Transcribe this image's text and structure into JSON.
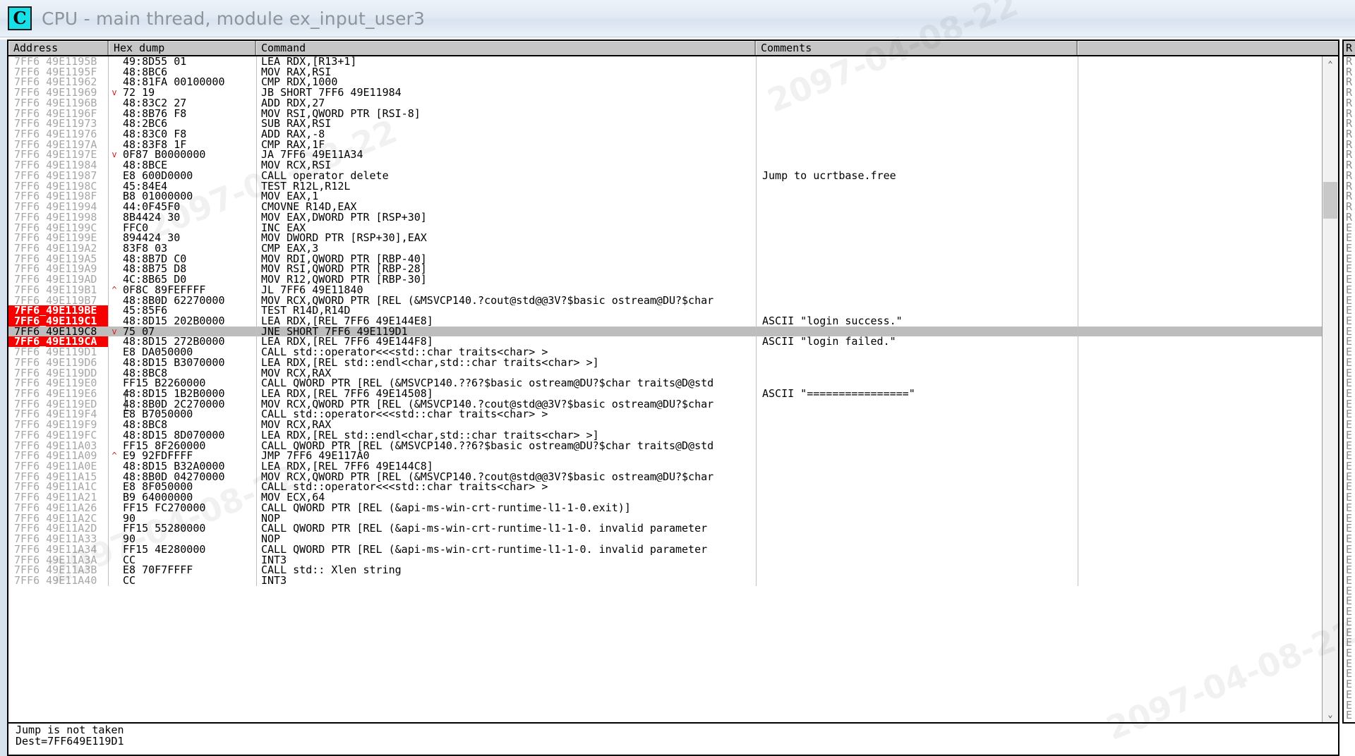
{
  "window": {
    "icon": "cpu-debugger-icon",
    "icon_glyph": "C",
    "title": "CPU - main thread, module ex_input_user3"
  },
  "watermark": {
    "text": "2097-04-08-22"
  },
  "columns": {
    "address": "Address",
    "hexdump": "Hex dump",
    "command": "Command",
    "comments": "Comments",
    "tail": ""
  },
  "right_pane": {
    "header": "R",
    "rows": [
      "R",
      "R",
      "R",
      "R",
      "R",
      "R",
      "R",
      "R",
      "R",
      "R",
      "R",
      "R",
      "R",
      "R",
      "R",
      "R",
      "E",
      "E",
      "E",
      "E",
      "E",
      "E",
      "E",
      "E",
      "E",
      "E",
      "E",
      "E",
      "E",
      "E",
      "E",
      "E",
      "E",
      "E",
      "E",
      "E",
      "E",
      "E",
      "E",
      "E",
      "E",
      "E",
      "E",
      "E",
      "E",
      "E",
      "E",
      "E",
      "E",
      "E",
      "E",
      "E",
      "E",
      "E",
      "E",
      "E",
      "E",
      "E",
      "E",
      "E",
      "E",
      "E",
      "E",
      "E"
    ]
  },
  "statusbar": {
    "line1": "Jump is not taken",
    "line2": "Dest=7FF649E119D1"
  },
  "colors": {
    "breakpoint_bg": "#f90000",
    "breakpoint_fg": "#ffffff",
    "selected_bg": "#bdbdbd",
    "address_fg": "#a7a7a7",
    "header_bg": "#c6c6c6",
    "arrow_fg": "#d02020",
    "icon_bg": "#18e0e8",
    "title_fg": "#8e949c"
  },
  "rows": [
    {
      "addr": "7FF6_49E1195B",
      "arrow": "",
      "hex": "49:8D55 01",
      "cmd": "LEA RDX,[R13+1]",
      "cmt": "",
      "bp": false,
      "sel": false
    },
    {
      "addr": "7FF6_49E1195F",
      "arrow": "",
      "hex": "48:8BC6",
      "cmd": "MOV RAX,RSI",
      "cmt": "",
      "bp": false,
      "sel": false
    },
    {
      "addr": "7FF6_49E11962",
      "arrow": "",
      "hex": "48:81FA 00100000",
      "cmd": "CMP RDX,1000",
      "cmt": "",
      "bp": false,
      "sel": false
    },
    {
      "addr": "7FF6_49E11969",
      "arrow": "v",
      "hex": "72 19",
      "cmd": "JB SHORT 7FF6_49E11984",
      "cmt": "",
      "bp": false,
      "sel": false
    },
    {
      "addr": "7FF6_49E1196B",
      "arrow": "",
      "hex": "48:83C2 27",
      "cmd": "ADD RDX,27",
      "cmt": "",
      "bp": false,
      "sel": false
    },
    {
      "addr": "7FF6_49E1196F",
      "arrow": "",
      "hex": "48:8B76 F8",
      "cmd": "MOV RSI,QWORD PTR [RSI-8]",
      "cmt": "",
      "bp": false,
      "sel": false
    },
    {
      "addr": "7FF6_49E11973",
      "arrow": "",
      "hex": "48:2BC6",
      "cmd": "SUB RAX,RSI",
      "cmt": "",
      "bp": false,
      "sel": false
    },
    {
      "addr": "7FF6_49E11976",
      "arrow": "",
      "hex": "48:83C0 F8",
      "cmd": "ADD RAX,-8",
      "cmt": "",
      "bp": false,
      "sel": false
    },
    {
      "addr": "7FF6_49E1197A",
      "arrow": "",
      "hex": "48:83F8 1F",
      "cmd": "CMP RAX,1F",
      "cmt": "",
      "bp": false,
      "sel": false
    },
    {
      "addr": "7FF6_49E1197E",
      "arrow": "v",
      "hex": "0F87 B0000000",
      "cmd": "JA 7FF6_49E11A34",
      "cmt": "",
      "bp": false,
      "sel": false
    },
    {
      "addr": "7FF6_49E11984",
      "arrow": "",
      "hex": "48:8BCE",
      "cmd": "MOV RCX,RSI",
      "cmt": "",
      "bp": false,
      "sel": false
    },
    {
      "addr": "7FF6_49E11987",
      "arrow": "",
      "hex": "E8 600D0000",
      "cmd": "CALL operator delete",
      "cmt": "Jump to ucrtbase.free",
      "bp": false,
      "sel": false
    },
    {
      "addr": "7FF6_49E1198C",
      "arrow": "",
      "hex": "45:84E4",
      "cmd": "TEST R12L,R12L",
      "cmt": "",
      "bp": false,
      "sel": false
    },
    {
      "addr": "7FF6_49E1198F",
      "arrow": "",
      "hex": "B8 01000000",
      "cmd": "MOV EAX,1",
      "cmt": "",
      "bp": false,
      "sel": false
    },
    {
      "addr": "7FF6_49E11994",
      "arrow": "",
      "hex": "44:0F45F0",
      "cmd": "CMOVNE R14D,EAX",
      "cmt": "",
      "bp": false,
      "sel": false
    },
    {
      "addr": "7FF6_49E11998",
      "arrow": "",
      "hex": "8B4424 30",
      "cmd": "MOV EAX,DWORD PTR [RSP+30]",
      "cmt": "",
      "bp": false,
      "sel": false
    },
    {
      "addr": "7FF6_49E1199C",
      "arrow": "",
      "hex": "FFC0",
      "cmd": "INC EAX",
      "cmt": "",
      "bp": false,
      "sel": false
    },
    {
      "addr": "7FF6_49E1199E",
      "arrow": "",
      "hex": "894424 30",
      "cmd": "MOV DWORD PTR [RSP+30],EAX",
      "cmt": "",
      "bp": false,
      "sel": false
    },
    {
      "addr": "7FF6_49E119A2",
      "arrow": "",
      "hex": "83F8 03",
      "cmd": "CMP EAX,3",
      "cmt": "",
      "bp": false,
      "sel": false
    },
    {
      "addr": "7FF6_49E119A5",
      "arrow": "",
      "hex": "48:8B7D C0",
      "cmd": "MOV RDI,QWORD PTR [RBP-40]",
      "cmt": "",
      "bp": false,
      "sel": false
    },
    {
      "addr": "7FF6_49E119A9",
      "arrow": "",
      "hex": "48:8B75 D8",
      "cmd": "MOV RSI,QWORD PTR [RBP-28]",
      "cmt": "",
      "bp": false,
      "sel": false
    },
    {
      "addr": "7FF6_49E119AD",
      "arrow": "",
      "hex": "4C:8B65 D0",
      "cmd": "MOV R12,QWORD PTR [RBP-30]",
      "cmt": "",
      "bp": false,
      "sel": false
    },
    {
      "addr": "7FF6_49E119B1",
      "arrow": "^",
      "hex": "0F8C 89FEFFFF",
      "cmd": "JL 7FF6_49E11840",
      "cmt": "",
      "bp": false,
      "sel": false
    },
    {
      "addr": "7FF6_49E119B7",
      "arrow": "",
      "hex": "48:8B0D 62270000",
      "cmd": "MOV RCX,QWORD PTR [REL (&MSVCP140.?cout@std@@3V?$basic_ostream@DU?$char",
      "cmt": "",
      "bp": false,
      "sel": false
    },
    {
      "addr": "7FF6_49E119BE",
      "arrow": "",
      "hex": "45:85F6",
      "cmd": "TEST R14D,R14D",
      "cmt": "",
      "bp": true,
      "sel": false
    },
    {
      "addr": "7FF6_49E119C1",
      "arrow": "",
      "hex": "48:8D15 202B0000",
      "cmd": "LEA RDX,[REL 7FF6_49E144E8]",
      "cmt": "ASCII \"login success.\"",
      "bp": true,
      "sel": false
    },
    {
      "addr": "7FF6_49E119C8",
      "arrow": "v",
      "hex": "75 07",
      "cmd": "JNE SHORT 7FF6_49E119D1",
      "cmt": "",
      "bp": false,
      "sel": true
    },
    {
      "addr": "7FF6_49E119CA",
      "arrow": "",
      "hex": "48:8D15 272B0000",
      "cmd": "LEA RDX,[REL 7FF6_49E144F8]",
      "cmt": "ASCII \"login failed.\"",
      "bp": true,
      "sel": false
    },
    {
      "addr": "7FF6_49E119D1",
      "arrow": "",
      "hex": "E8 DA050000",
      "cmd": "CALL std::operator<<<std::char_traits<char> >",
      "cmt": "",
      "bp": false,
      "sel": false
    },
    {
      "addr": "7FF6_49E119D6",
      "arrow": "",
      "hex": "48:8D15 B3070000",
      "cmd": "LEA RDX,[REL std::endl<char,std::char_traits<char> >]",
      "cmt": "",
      "bp": false,
      "sel": false
    },
    {
      "addr": "7FF6_49E119DD",
      "arrow": "",
      "hex": "48:8BC8",
      "cmd": "MOV RCX,RAX",
      "cmt": "",
      "bp": false,
      "sel": false
    },
    {
      "addr": "7FF6_49E119E0",
      "arrow": "",
      "hex": "FF15 B2260000",
      "cmd": "CALL QWORD PTR [REL (&MSVCP140.??6?$basic_ostream@DU?$char_traits@D@std",
      "cmt": "",
      "bp": false,
      "sel": false
    },
    {
      "addr": "7FF6_49E119E6",
      "arrow": "",
      "hex": "48:8D15 1B2B0000",
      "cmd": "LEA RDX,[REL 7FF6_49E14508]",
      "cmt": "ASCII \"================\"",
      "bp": false,
      "sel": false
    },
    {
      "addr": "7FF6_49E119ED",
      "arrow": "",
      "hex": "48:8B0D 2C270000",
      "cmd": "MOV RCX,QWORD PTR [REL (&MSVCP140.?cout@std@@3V?$basic_ostream@DU?$char",
      "cmt": "",
      "bp": false,
      "sel": false
    },
    {
      "addr": "7FF6_49E119F4",
      "arrow": "",
      "hex": "E8 B7050000",
      "cmd": "CALL std::operator<<<std::char_traits<char> >",
      "cmt": "",
      "bp": false,
      "sel": false
    },
    {
      "addr": "7FF6_49E119F9",
      "arrow": "",
      "hex": "48:8BC8",
      "cmd": "MOV RCX,RAX",
      "cmt": "",
      "bp": false,
      "sel": false
    },
    {
      "addr": "7FF6_49E119FC",
      "arrow": "",
      "hex": "48:8D15 8D070000",
      "cmd": "LEA RDX,[REL std::endl<char,std::char_traits<char> >]",
      "cmt": "",
      "bp": false,
      "sel": false
    },
    {
      "addr": "7FF6_49E11A03",
      "arrow": "",
      "hex": "FF15 8F260000",
      "cmd": "CALL QWORD PTR [REL (&MSVCP140.??6?$basic_ostream@DU?$char_traits@D@std",
      "cmt": "",
      "bp": false,
      "sel": false
    },
    {
      "addr": "7FF6_49E11A09",
      "arrow": "^",
      "hex": "E9 92FDFFFF",
      "cmd": "JMP 7FF6_49E117A0",
      "cmt": "",
      "bp": false,
      "sel": false
    },
    {
      "addr": "7FF6_49E11A0E",
      "arrow": "",
      "hex": "48:8D15 B32A0000",
      "cmd": "LEA RDX,[REL 7FF6_49E144C8]",
      "cmt": "",
      "bp": false,
      "sel": false
    },
    {
      "addr": "7FF6_49E11A15",
      "arrow": "",
      "hex": "48:8B0D 04270000",
      "cmd": "MOV RCX,QWORD PTR [REL (&MSVCP140.?cout@std@@3V?$basic_ostream@DU?$char",
      "cmt": "",
      "bp": false,
      "sel": false
    },
    {
      "addr": "7FF6_49E11A1C",
      "arrow": "",
      "hex": "E8 8F050000",
      "cmd": "CALL std::operator<<<std::char_traits<char> >",
      "cmt": "",
      "bp": false,
      "sel": false
    },
    {
      "addr": "7FF6_49E11A21",
      "arrow": "",
      "hex": "B9 64000000",
      "cmd": "MOV ECX,64",
      "cmt": "",
      "bp": false,
      "sel": false
    },
    {
      "addr": "7FF6_49E11A26",
      "arrow": "",
      "hex": "FF15 FC270000",
      "cmd": "CALL QWORD PTR [REL (&api-ms-win-crt-runtime-l1-1-0.exit)]",
      "cmt": "",
      "bp": false,
      "sel": false
    },
    {
      "addr": "7FF6_49E11A2C",
      "arrow": "",
      "hex": "90",
      "cmd": "NOP",
      "cmt": "",
      "bp": false,
      "sel": false
    },
    {
      "addr": "7FF6_49E11A2D",
      "arrow": "",
      "hex": "FF15 55280000",
      "cmd": "CALL QWORD PTR [REL (&api-ms-win-crt-runtime-l1-1-0._invalid_parameter_",
      "cmt": "",
      "bp": false,
      "sel": false
    },
    {
      "addr": "7FF6_49E11A33",
      "arrow": "",
      "hex": "90",
      "cmd": "NOP",
      "cmt": "",
      "bp": false,
      "sel": false
    },
    {
      "addr": "7FF6_49E11A34",
      "arrow": "",
      "hex": "FF15 4E280000",
      "cmd": "CALL QWORD PTR [REL (&api-ms-win-crt-runtime-l1-1-0._invalid_parameter_",
      "cmt": "",
      "bp": false,
      "sel": false
    },
    {
      "addr": "7FF6_49E11A3A",
      "arrow": "",
      "hex": "CC",
      "cmd": "INT3",
      "cmt": "",
      "bp": false,
      "sel": false
    },
    {
      "addr": "7FF6_49E11A3B",
      "arrow": "",
      "hex": "E8 70F7FFFF",
      "cmd": "CALL std::_Xlen_string",
      "cmt": "",
      "bp": false,
      "sel": false
    },
    {
      "addr": "7FF6_49E11A40",
      "arrow": "",
      "hex": "CC",
      "cmd": "INT3",
      "cmt": "",
      "bp": false,
      "sel": false
    }
  ],
  "scrollbar": {
    "up_arrow": "scroll-up-arrow-icon",
    "down_arrow": "scroll-down-arrow-icon",
    "up_glyph": "⌃",
    "down_glyph": "⌄"
  }
}
